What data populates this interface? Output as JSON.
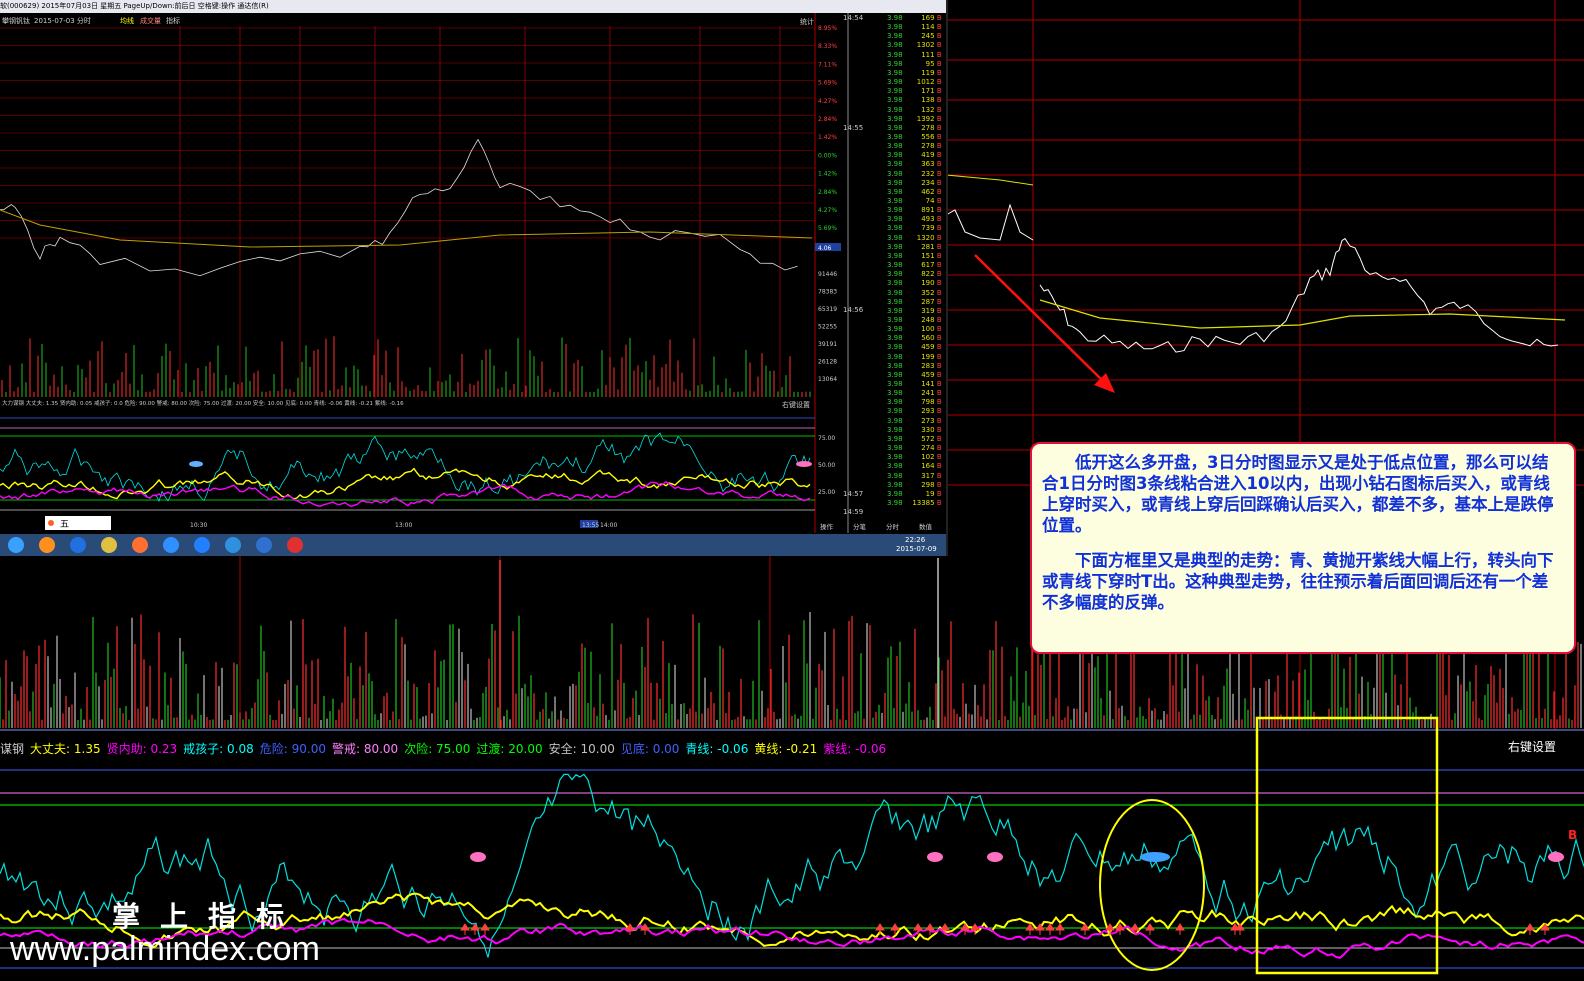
{
  "inset": {
    "titlebar": "软(000629) 2015年07月03日 星期五 PageUp/Down:前后日 空格键:操作 通达信(R)",
    "chart_header": [
      "攀钢钒钛",
      "2015-07-03 分时",
      "均线",
      "成交量",
      "指标"
    ],
    "stat_label": "统计",
    "pct_labels": [
      "8.95%",
      "8.33%",
      "7.11%",
      "5.69%",
      "4.27%",
      "2.84%",
      "1.42%",
      "0.00%",
      "1.42%",
      "2.84%",
      "4.27%",
      "5.69%",
      "7.11%"
    ],
    "price_highlight": "4.06",
    "vol_labels": [
      "91446",
      "78383",
      "65319",
      "52255",
      "39191",
      "26128",
      "13064"
    ],
    "indicator_header": "大力谋钢 大丈夫: 1.35 贤内助: 0.05 戒孩子: 0.0 危险: 90.00 警戒: 80.00 次险: 75.00 过渡: 20.00 安全: 10.00 见底: 0.00 青线: -0.06 黄线: -0.21 紫线: -0.16",
    "right_setting": "右键设置",
    "ind_levels": [
      "75.00",
      "50.00",
      "25.00"
    ],
    "time_labels": [
      "10:30",
      "13:00",
      "13:55",
      "14:00"
    ],
    "tick_times": [
      "14:54",
      "14:55",
      "14:56",
      "14:57",
      "14:59"
    ],
    "tick_price": "3.98",
    "tick_volumes": [
      "169",
      "114",
      "245",
      "1302",
      "111",
      "95",
      "119",
      "1012",
      "171",
      "138",
      "132",
      "1392",
      "278",
      "556",
      "278",
      "419",
      "363",
      "232",
      "234",
      "462",
      "74",
      "891",
      "493",
      "739",
      "1320",
      "281",
      "151",
      "617",
      "822",
      "190",
      "352",
      "287",
      "319",
      "248",
      "100",
      "560",
      "459",
      "199",
      "283",
      "459",
      "141",
      "241",
      "798",
      "293",
      "273",
      "330",
      "572",
      "274",
      "102",
      "164",
      "317",
      "298",
      "19",
      "13385"
    ],
    "tick_tabs": [
      "操作",
      "分笔",
      "分时",
      "数值"
    ],
    "toolbar_label": "五",
    "clock_time": "22:26",
    "clock_date": "2015-07-09"
  },
  "main_indicator": {
    "name_fragment": "谋钢",
    "items": [
      {
        "label": "大丈夫:",
        "value": "1.35",
        "color": "#ffff00"
      },
      {
        "label": "贤内助:",
        "value": "0.23",
        "color": "#ff00ff"
      },
      {
        "label": "戒孩子:",
        "value": "0.08",
        "color": "#00ffff"
      },
      {
        "label": "危险:",
        "value": "90.00",
        "color": "#4060ff"
      },
      {
        "label": "警戒:",
        "value": "80.00",
        "color": "#ff80ff"
      },
      {
        "label": "次险:",
        "value": "75.00",
        "color": "#00ff00"
      },
      {
        "label": "过渡:",
        "value": "20.00",
        "color": "#00ff00"
      },
      {
        "label": "安全:",
        "value": "10.00",
        "color": "#c0c0c0"
      },
      {
        "label": "见底:",
        "value": "0.00",
        "color": "#4060ff"
      },
      {
        "label": "青线:",
        "value": "-0.06",
        "color": "#00ffff"
      },
      {
        "label": "黄线:",
        "value": "-0.21",
        "color": "#ffff00"
      },
      {
        "label": "紫线:",
        "value": "-0.06",
        "color": "#ff00ff"
      }
    ],
    "right_setting": "右键设置",
    "signal_label": "B"
  },
  "callout": {
    "para1": "低开这么多开盘，3日分时图显示又是处于低点位置，那么可以结合1日分时图3条线粘合进入10以内，出现小钻石图标后买入，或青线上穿时买入，或青线上穿后回踩确认后买入，都差不多，基本上是跌停位置。",
    "para2": "下面方框里又是典型的走势：青、黄抛开紫线大幅上行，转头向下或青线下穿时T出。这种典型走势，往往预示着后面回调后还有一个差不多幅度的反弹。"
  },
  "watermark": {
    "cn": "掌上指标",
    "url": "www.palmindex.com"
  },
  "colors": {
    "grid_red": "#b00000",
    "price_line": "#ffffff",
    "avg_line": "#e0e000",
    "cyan": "#00e0e0",
    "yellow": "#ffff00",
    "magenta": "#ff00ff",
    "callout_text": "#1030d8",
    "callout_border": "#e0103a",
    "highlight_box": "#ffff00"
  },
  "chart_data": {
    "type": "line",
    "note_series": [
      "price",
      "average",
      "cyan",
      "yellow",
      "magenta"
    ],
    "indicator_levels": [
      90,
      80,
      75,
      20,
      10,
      0
    ]
  }
}
